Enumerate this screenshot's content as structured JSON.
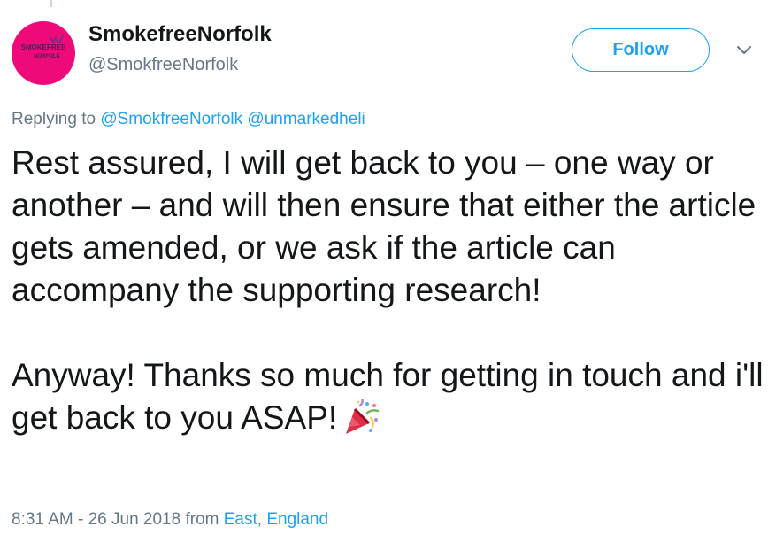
{
  "author": {
    "display_name": "SmokefreeNorfolk",
    "handle": "@SmokfreeNorfolk",
    "avatar_text_top": "SMOKEFREE",
    "avatar_text_bottom": "NORFOLK",
    "avatar_color": "#ee0a78"
  },
  "header": {
    "follow_label": "Follow",
    "menu_icon": "chevron-down-icon"
  },
  "reply": {
    "prefix": "Replying to",
    "mentions": [
      "@SmokfreeNorfolk",
      "@unmarkedheli"
    ]
  },
  "tweet": {
    "paragraph_1": "Rest assured, I will get back to you – one way or another – and will then ensure that either the article gets amended, or we ask if the article can accompany the supporting research!",
    "paragraph_2": "Anyway! Thanks so much for getting in touch and i'll get back to you ASAP!",
    "emoji": "party-popper-icon"
  },
  "meta": {
    "timestamp": "8:31 AM - 26 Jun 2018",
    "from_label": "from",
    "location": "East, England"
  },
  "colors": {
    "accent": "#1da1f2",
    "muted": "#657786",
    "text": "#14171a"
  }
}
